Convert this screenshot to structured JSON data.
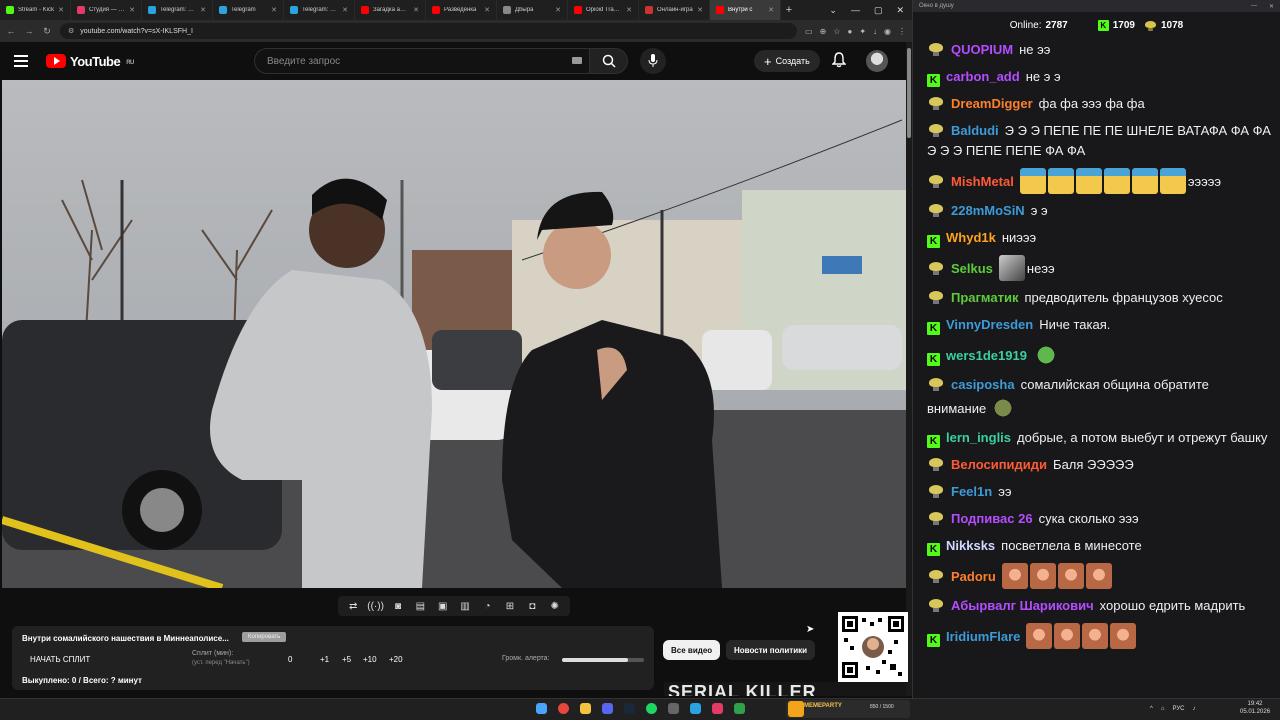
{
  "browser": {
    "tabs": [
      {
        "title": "Stream - Kick",
        "color": "#53fc18"
      },
      {
        "title": "Студия — VK",
        "color": "#e63a66"
      },
      {
        "title": "Telegram: View",
        "color": "#2aa3e0"
      },
      {
        "title": "Telegram",
        "color": "#2aa3e0"
      },
      {
        "title": "Telegram: View",
        "color": "#2aa3e0"
      },
      {
        "title": "Загадка аренд",
        "color": "#ff0000"
      },
      {
        "title": "Разведенка",
        "color": "#ff0000"
      },
      {
        "title": "Дbыра",
        "color": "#888888"
      },
      {
        "title": "Opioid Tragedy",
        "color": "#ff0000"
      },
      {
        "title": "Онлайн-игра",
        "color": "#cc3333"
      },
      {
        "title": "Внутри с",
        "color": "#ff0000",
        "active": true
      }
    ],
    "url": "youtube.com/watch?v=sX-IKLSFH_I"
  },
  "youtube": {
    "region": "RU",
    "search_placeholder": "Введите запрос",
    "create_label": "Создать"
  },
  "split": {
    "video_title": "Внутри сомалийского нашествия в Миннеаполисе...",
    "copy_label": "Копировать",
    "start_label": "НАЧАТЬ СПЛИТ",
    "split_label": "Сплит (мин):",
    "split_hint": "(уст. перед \"Начать\")",
    "value": "0",
    "increments": [
      "+1",
      "+5",
      "+10",
      "+20"
    ],
    "volume_label": "Громк. алерта:",
    "volume_level": 0.8,
    "bought": "Выкуплено: 0 / Всего: ? минут"
  },
  "chips": {
    "all_videos": "Все видео",
    "policy_news": "Новости политики"
  },
  "thumbnail_text": "SERIAL KILLER",
  "chat": {
    "window_title": "Окно в душу",
    "online_label": "Online:",
    "online_count": "2787",
    "kick_count": "1709",
    "bean_count": "1078",
    "messages": [
      {
        "badge": "b",
        "user": "QUOPIUM",
        "color": "#b44dff",
        "text": "не ээ"
      },
      {
        "badge": "k",
        "user": "carbon_add",
        "color": "#b44dff",
        "text": "не э э"
      },
      {
        "badge": "b",
        "user": "DreamDigger",
        "color": "#ff7f2a",
        "text": "фа фа эээ фа фа"
      },
      {
        "badge": "b",
        "user": "Baldudi",
        "color": "#3d9bd8",
        "text": "Э Э Э ПЕПЕ ПЕ ПЕ ШНЕЛЕ ВАТАФА ФА ФА Э Э Э ПЕПЕ ПЕПЕ ФА ФА"
      },
      {
        "badge": "b",
        "user": "MishMetal",
        "color": "#ff5a36",
        "emotes": [
          "pepe",
          "pepe",
          "pepe",
          "pepe",
          "pepe",
          "pepe"
        ],
        "text": "эээээ"
      },
      {
        "badge": "b",
        "user": "228mMoSiN",
        "color": "#3d9bd8",
        "text": "э э"
      },
      {
        "badge": "k",
        "user": "Whyd1k",
        "color": "#ffa31a",
        "text": "ниэээ"
      },
      {
        "badge": "b",
        "user": "Selkus",
        "color": "#5ecb3a",
        "emotes": [
          "smoke"
        ],
        "text": "неээ"
      },
      {
        "badge": "b",
        "user": "Прагматик",
        "color": "#5ecb3a",
        "text": "предводитель французов хуесос"
      },
      {
        "badge": "k",
        "user": "VinnyDresden",
        "color": "#3d9bd8",
        "text": "Ниче такая."
      },
      {
        "badge": "k",
        "user": "wers1de1919",
        "color": "#3ad0a0",
        "emotes": [
          "frog"
        ],
        "text": ""
      },
      {
        "badge": "b",
        "user": "casiposha",
        "color": "#3d9bd8",
        "text": "сомалийская община обратите внимание",
        "emotes_after": [
          "goblin"
        ]
      },
      {
        "badge": "k",
        "user": "lern_inglis",
        "color": "#3ad0a0",
        "text": "добрые, а потом выебут и отрежут башку"
      },
      {
        "badge": "b",
        "user": "Велосипидиди",
        "color": "#ff5a36",
        "text": "Баля ЭЭЭЭЭ"
      },
      {
        "badge": "b",
        "user": "Feel1n",
        "color": "#3d9bd8",
        "text": "ээ"
      },
      {
        "badge": "b",
        "user": "Подпивас 26",
        "color": "#b44dff",
        "text": "сука сколько эээ"
      },
      {
        "badge": "k",
        "user": "Nikksks",
        "color": "#cfd8ff",
        "text": "посветлела в минесоте"
      },
      {
        "badge": "b",
        "user": "Padoru",
        "color": "#ff7f2a",
        "emotes": [
          "face",
          "face",
          "face",
          "face"
        ],
        "text": ""
      },
      {
        "badge": "b",
        "user": "Абырвалг Шарикович",
        "color": "#b44dff",
        "text": "хорошо едрить мадрить"
      },
      {
        "badge": "k",
        "user": "IridiumFlare",
        "color": "#3d9bd8",
        "emotes": [
          "face",
          "face",
          "face",
          "face"
        ],
        "text": ""
      }
    ]
  },
  "taskbar": {
    "weather": "MEMEPARTY",
    "weather_sub": "850 / 1500",
    "lang": "РУС",
    "time": "19:42",
    "date": "05.01.2026"
  }
}
